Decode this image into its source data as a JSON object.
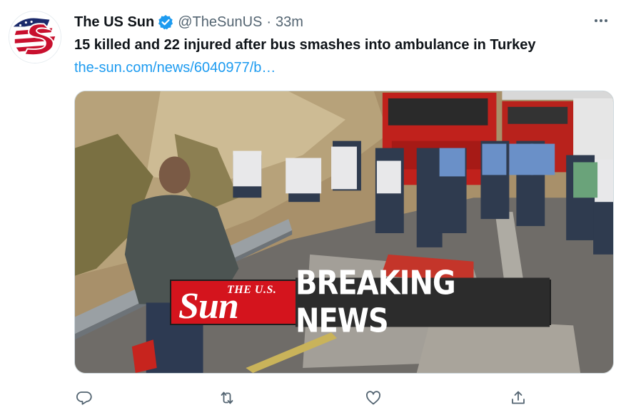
{
  "author": {
    "name": "The US Sun",
    "handle": "@TheSunUS",
    "separator": "·",
    "time": "33m",
    "verified": true
  },
  "tweet": {
    "text": "15 killed and 22 injured after bus smashes into ambulance in Turkey",
    "link": "the-sun.com/news/6040977/b…"
  },
  "media": {
    "banner_logo_small": "THE U.S.",
    "banner_logo_big": "Sun",
    "banner_text": "BREAKING NEWS"
  },
  "actions": {
    "reply_icon": "reply-icon",
    "retweet_icon": "retweet-icon",
    "like_icon": "like-icon",
    "share_icon": "share-icon"
  },
  "colors": {
    "accent": "#1d9bf0",
    "text_primary": "#0f1419",
    "text_secondary": "#536471",
    "banner_red": "#d4141d"
  }
}
